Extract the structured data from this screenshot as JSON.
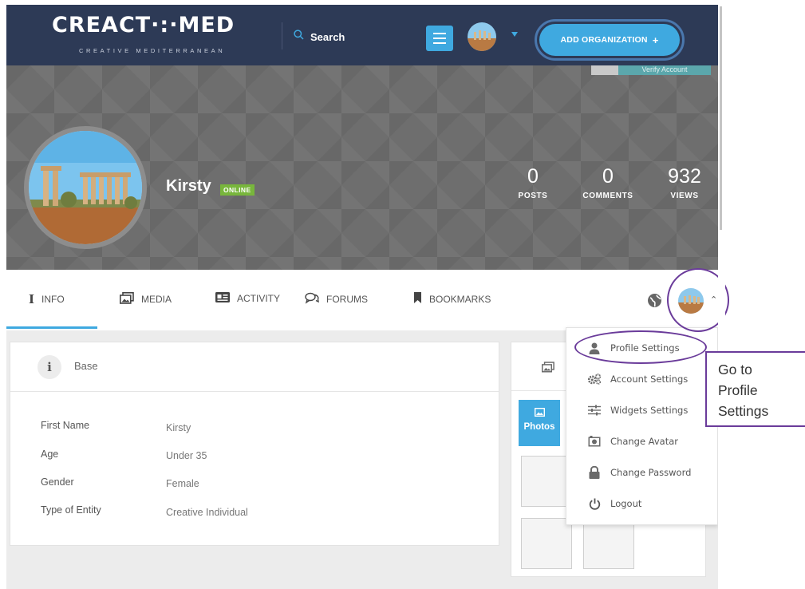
{
  "header": {
    "logo_text": "CREACT·:·MED",
    "logo_tagline": "CREATIVE MEDITERRANEAN",
    "search_label": "Search",
    "add_org_label": "ADD ORGANIZATION",
    "add_org_plus": "+"
  },
  "cover": {
    "button_partial_text": "Verify Account",
    "name": "Kirsty",
    "status_badge": "ONLINE",
    "stats": [
      {
        "value": "0",
        "label": "POSTS"
      },
      {
        "value": "0",
        "label": "COMMENTS"
      },
      {
        "value": "932",
        "label": "VIEWS"
      }
    ]
  },
  "tabs": [
    {
      "label": "INFO",
      "icon": "info-icon",
      "active": true
    },
    {
      "label": "MEDIA",
      "icon": "images-icon"
    },
    {
      "label": "ACTIVITY",
      "icon": "id-card-icon"
    },
    {
      "label": "FORUMS",
      "icon": "chat-bubbles-icon"
    },
    {
      "label": "BOOKMARKS",
      "icon": "bookmark-icon"
    }
  ],
  "base_card": {
    "title": "Base",
    "fields": [
      {
        "label": "First Name",
        "value": "Kirsty"
      },
      {
        "label": "Age",
        "value": "Under 35"
      },
      {
        "label": "Gender",
        "value": "Female"
      },
      {
        "label": "Type of Entity",
        "value": "Creative Individual"
      }
    ]
  },
  "media_card": {
    "photos_label": "Photos"
  },
  "dropdown": {
    "items": [
      {
        "label": "Profile Settings",
        "icon": "user-icon"
      },
      {
        "label": "Account Settings",
        "icon": "gears-icon"
      },
      {
        "label": "Widgets Settings",
        "icon": "sliders-icon"
      },
      {
        "label": "Change Avatar",
        "icon": "camera-icon"
      },
      {
        "label": "Change Password",
        "icon": "lock-icon"
      },
      {
        "label": "Logout",
        "icon": "power-icon"
      }
    ]
  },
  "annotation": {
    "callout_line1": "Go to",
    "callout_line2": "Profile",
    "callout_line3": "Settings"
  },
  "colors": {
    "header_bg": "#2d3a56",
    "accent_blue": "#3fa9e0",
    "online_green": "#78b63c",
    "annotation_purple": "#6a3b9a"
  }
}
